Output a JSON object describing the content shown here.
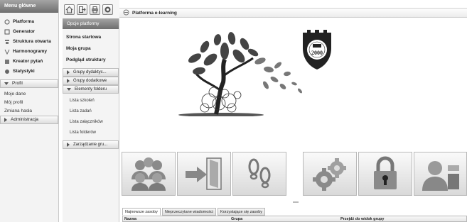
{
  "left_menu": {
    "header": "Menu główne",
    "items": [
      {
        "label": "Platforma",
        "icon": "platform-icon"
      },
      {
        "label": "Generator",
        "icon": "generator-icon"
      },
      {
        "label": "Struktura otwarta",
        "icon": "structure-icon"
      },
      {
        "label": "Harmonogramy",
        "icon": "schedule-icon"
      },
      {
        "label": "Kreator pytań",
        "icon": "question-creator-icon"
      },
      {
        "label": "Statystyki",
        "icon": "statistics-icon"
      }
    ],
    "profile_section": "Profil",
    "profile_items": [
      "Moje dane",
      "Mój profil",
      "Zmiana hasła"
    ],
    "admin_section": "Administracja"
  },
  "toolbar": {
    "buttons": [
      "home-icon",
      "logout-icon",
      "print-icon",
      "help-icon"
    ]
  },
  "mid_menu": {
    "header": "Opcje platformy",
    "items": [
      "Strona startowa",
      "Moja grupa",
      "Podgląd struktury"
    ],
    "sections": [
      "Grupy dydaktyc...",
      "Grupy dodatkowe",
      "Elementy folderu"
    ],
    "folder_items": [
      "Lista szkoleń",
      "Lista zadań",
      "Lista załączników",
      "Lista folderów"
    ],
    "section_last": "Zarządzanie gru..."
  },
  "title": "Platforma e-learning",
  "logo": {
    "text": "2000"
  },
  "big_buttons": [
    "group-icon",
    "login-door-icon",
    "footsteps-icon",
    "settings-gears-icon",
    "lock-icon",
    "user-details-icon"
  ],
  "tabs": [
    "Najnowsze zasoby",
    "Nieprzeczytane wiadomości",
    "Korzystające się zasoby"
  ],
  "table_headers": [
    "Nazwa",
    "Grupa",
    "Przejdź do widok grupy"
  ],
  "colors": {
    "header_dark": "#6e6e6e",
    "panel_bg": "#f3f3f3"
  }
}
